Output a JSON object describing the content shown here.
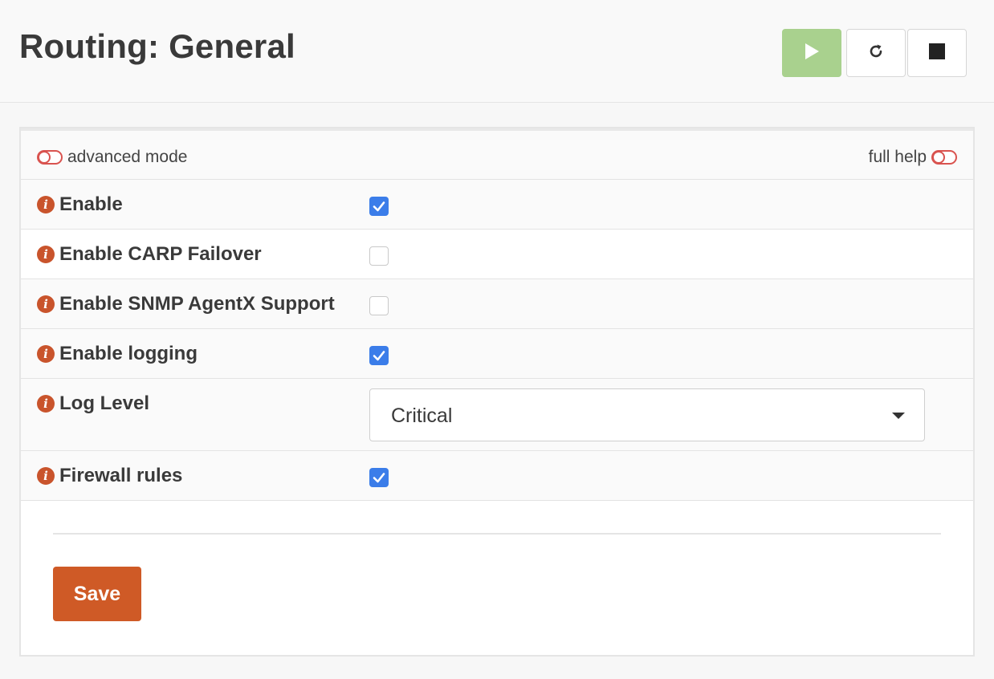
{
  "page": {
    "title": "Routing: General"
  },
  "service_buttons": {
    "play": "play-icon",
    "restart": "refresh-icon",
    "stop": "stop-icon"
  },
  "mode_bar": {
    "advanced_mode_label": "advanced mode",
    "full_help_label": "full help"
  },
  "fields": [
    {
      "label": "Enable",
      "type": "checkbox",
      "checked": true
    },
    {
      "label": "Enable CARP Failover",
      "type": "checkbox",
      "checked": false
    },
    {
      "label": "Enable SNMP AgentX Support",
      "type": "checkbox",
      "checked": false
    },
    {
      "label": "Enable logging",
      "type": "checkbox",
      "checked": true
    },
    {
      "label": "Log Level",
      "type": "select",
      "value": "Critical"
    },
    {
      "label": "Firewall rules",
      "type": "checkbox",
      "checked": true
    }
  ],
  "actions": {
    "save_label": "Save"
  },
  "colors": {
    "accent": "#cf5a26",
    "play_button": "#a9d18e",
    "checkbox_checked": "#3b7de9",
    "info_icon": "#c9542c",
    "toggle": "#d9534f"
  }
}
